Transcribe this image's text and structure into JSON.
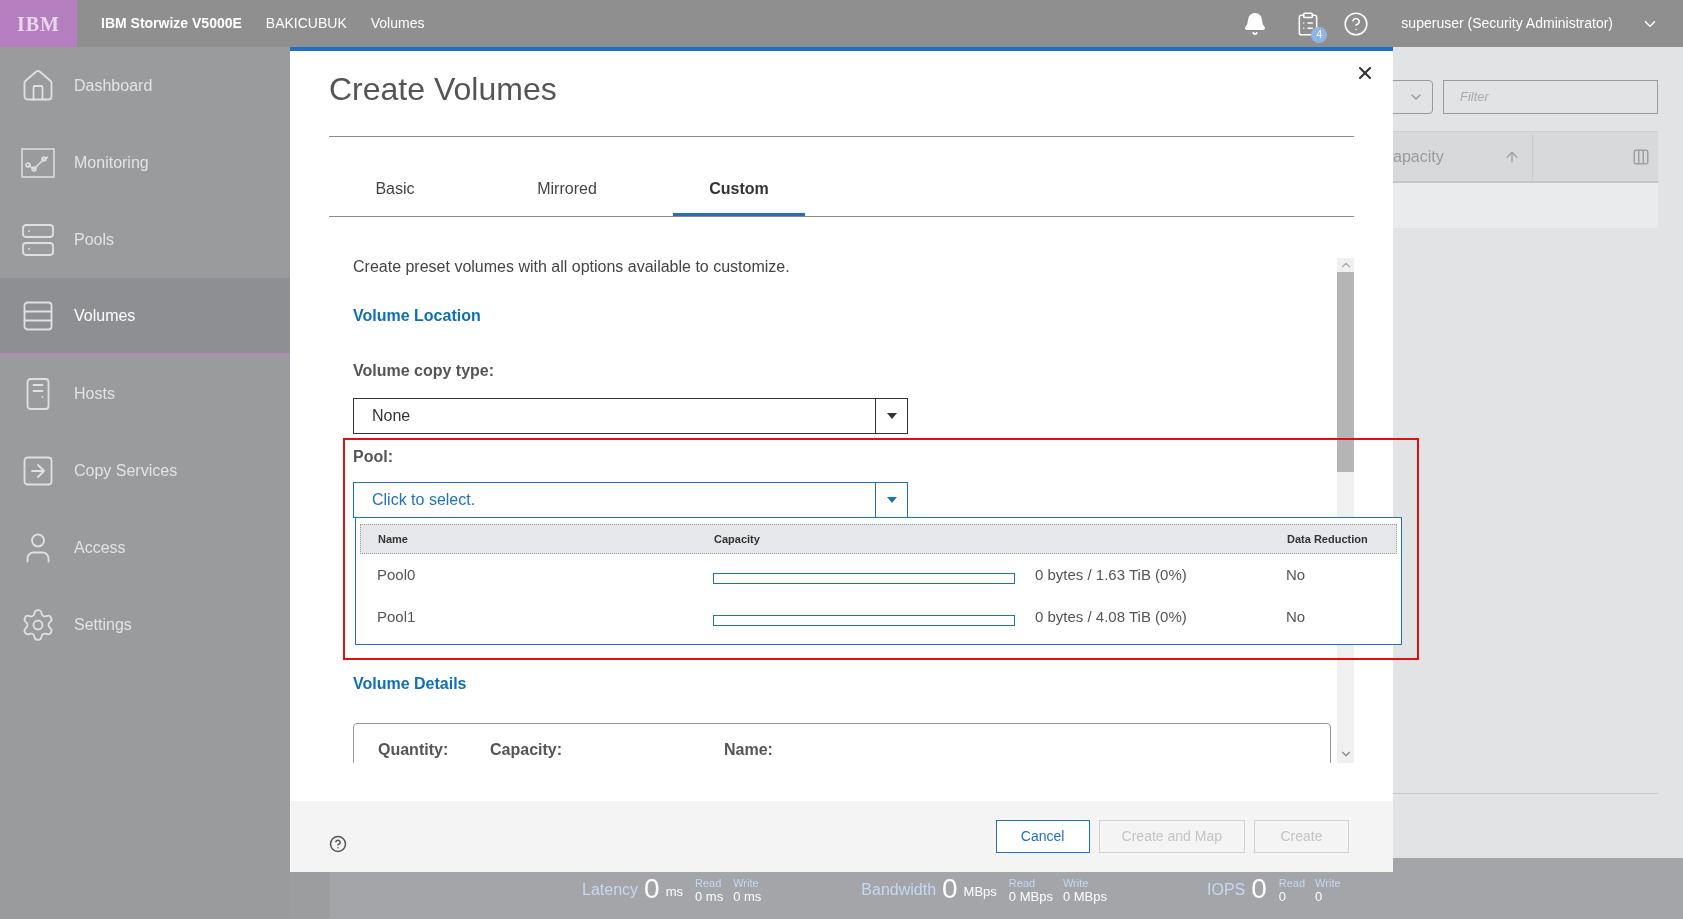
{
  "header": {
    "logo": "IBM",
    "product": "IBM Storwize V5000E",
    "system": "BAKICUBUK",
    "breadcrumb": "Volumes",
    "task_count": "4",
    "user": "superuser (Security Administrator)"
  },
  "sidebar": {
    "items": [
      {
        "label": "Dashboard",
        "selected": false
      },
      {
        "label": "Monitoring",
        "selected": false
      },
      {
        "label": "Pools",
        "selected": false
      },
      {
        "label": "Volumes",
        "selected": true
      },
      {
        "label": "Hosts",
        "selected": false
      },
      {
        "label": "Copy Services",
        "selected": false
      },
      {
        "label": "Access",
        "selected": false
      },
      {
        "label": "Settings",
        "selected": false
      }
    ]
  },
  "background": {
    "filter_placeholder": "Filter",
    "column_header": "apacity"
  },
  "status_bar": {
    "groups": [
      {
        "label": "Latency",
        "value": "0",
        "unit": "ms",
        "read_label": "Read",
        "read": "0 ms",
        "write_label": "Write",
        "write": "0 ms"
      },
      {
        "label": "Bandwidth",
        "value": "0",
        "unit": "MBps",
        "read_label": "Read",
        "read": "0 MBps",
        "write_label": "Write",
        "write": "0 MBps"
      },
      {
        "label": "IOPS",
        "value": "0",
        "read_label": "Read",
        "read": "0",
        "write_label": "Write",
        "write": "0"
      }
    ]
  },
  "dialog": {
    "title": "Create Volumes",
    "tabs": [
      {
        "label": "Basic",
        "selected": false
      },
      {
        "label": "Mirrored",
        "selected": false
      },
      {
        "label": "Custom",
        "selected": true
      }
    ],
    "description": "Create preset volumes with all options available to customize.",
    "location_title": "Volume Location",
    "copy_type": {
      "label": "Volume copy type:",
      "value": "None"
    },
    "pool": {
      "label": "Pool:",
      "prompt": "Click to select.",
      "expanded": true,
      "highlighted": true,
      "columns": [
        "Name",
        "Capacity",
        "Data Reduction"
      ],
      "rows": [
        {
          "name": "Pool0",
          "level": 0,
          "capacity": "0 bytes / 1.63 TiB (0%)",
          "data_reduction": "No"
        },
        {
          "name": "Pool1",
          "level": 0,
          "capacity": "0 bytes / 4.08 TiB (0%)",
          "data_reduction": "No"
        }
      ]
    },
    "details_title": "Volume Details",
    "details_columns": [
      "Quantity:",
      "Capacity:",
      "Name:"
    ],
    "buttons": [
      {
        "label": "Cancel",
        "disabled": false
      },
      {
        "label": "Create and Map",
        "disabled": true
      },
      {
        "label": "Create",
        "disabled": true
      }
    ]
  }
}
